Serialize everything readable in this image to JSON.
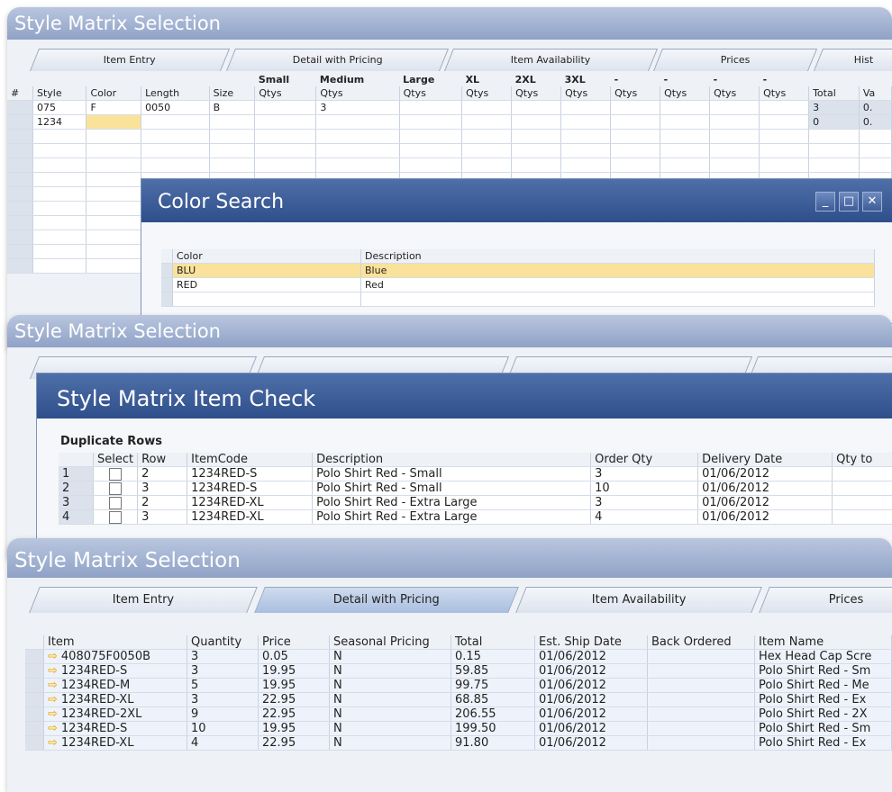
{
  "panel1": {
    "title": "Style Matrix Selection",
    "tabs": [
      "Item Entry",
      "Detail with Pricing",
      "Item Availability",
      "Prices",
      "Hist"
    ],
    "size_headers": [
      "Small",
      "Medium",
      "Large",
      "XL",
      "2XL",
      "3XL",
      "-",
      "-",
      "-",
      "-"
    ],
    "columns": [
      "#",
      "Style",
      "Color",
      "Length",
      "Size",
      "Qtys",
      "Qtys",
      "Qtys",
      "Qtys",
      "Qtys",
      "Qtys",
      "Qtys",
      "Qtys",
      "Qtys",
      "Qtys",
      "Total",
      "Va"
    ],
    "rows": [
      {
        "num": "",
        "style": "075",
        "color": "F",
        "length": "0050",
        "size": "B",
        "q2": "3",
        "total": "3",
        "va": "0."
      },
      {
        "num": "",
        "style": "1234",
        "color": "",
        "length": "",
        "size": "",
        "q2": "",
        "total": "0",
        "va": "0."
      }
    ]
  },
  "color_search": {
    "title": "Color Search",
    "columns": [
      "Color",
      "Description"
    ],
    "rows": [
      {
        "color": "BLU",
        "description": "Blue"
      },
      {
        "color": "RED",
        "description": "Red"
      }
    ]
  },
  "panel2": {
    "title": "Style Matrix Selection"
  },
  "item_check": {
    "title": "Style Matrix Item Check",
    "section": "Duplicate Rows",
    "columns": [
      "",
      "Select",
      "Row",
      "ItemCode",
      "Description",
      "Order Qty",
      "Delivery Date",
      "Qty to"
    ],
    "rows": [
      {
        "num": "1",
        "row": "2",
        "code": "1234RED-S",
        "desc": "Polo Shirt Red - Small",
        "qty": "3",
        "date": "01/06/2012"
      },
      {
        "num": "2",
        "row": "3",
        "code": "1234RED-S",
        "desc": "Polo Shirt Red - Small",
        "qty": "10",
        "date": "01/06/2012"
      },
      {
        "num": "3",
        "row": "2",
        "code": "1234RED-XL",
        "desc": "Polo Shirt Red - Extra Large",
        "qty": "3",
        "date": "01/06/2012"
      },
      {
        "num": "4",
        "row": "3",
        "code": "1234RED-XL",
        "desc": "Polo Shirt Red - Extra Large",
        "qty": "4",
        "date": "01/06/2012"
      }
    ]
  },
  "panel3": {
    "title": "Style Matrix Selection",
    "tabs": [
      "Item Entry",
      "Detail with Pricing",
      "Item Availability",
      "Prices"
    ],
    "columns": [
      "Item",
      "Quantity",
      "Price",
      "Seasonal Pricing",
      "Total",
      "Est. Ship Date",
      "Back Ordered",
      "Item Name"
    ],
    "rows": [
      {
        "item": "408075F0050B",
        "qty": "3",
        "price": "0.05",
        "seasonal": "N",
        "total": "0.15",
        "date": "01/06/2012",
        "name": "Hex Head Cap Scre"
      },
      {
        "item": "1234RED-S",
        "qty": "3",
        "price": "19.95",
        "seasonal": "N",
        "total": "59.85",
        "date": "01/06/2012",
        "name": "Polo Shirt Red - Sm"
      },
      {
        "item": "1234RED-M",
        "qty": "5",
        "price": "19.95",
        "seasonal": "N",
        "total": "99.75",
        "date": "01/06/2012",
        "name": "Polo Shirt Red - Me"
      },
      {
        "item": "1234RED-XL",
        "qty": "3",
        "price": "22.95",
        "seasonal": "N",
        "total": "68.85",
        "date": "01/06/2012",
        "name": "Polo Shirt Red - Ex"
      },
      {
        "item": "1234RED-2XL",
        "qty": "9",
        "price": "22.95",
        "seasonal": "N",
        "total": "206.55",
        "date": "01/06/2012",
        "name": "Polo Shirt Red - 2X"
      },
      {
        "item": "1234RED-S",
        "qty": "10",
        "price": "19.95",
        "seasonal": "N",
        "total": "199.50",
        "date": "01/06/2012",
        "name": "Polo Shirt Red - Sm"
      },
      {
        "item": "1234RED-XL",
        "qty": "4",
        "price": "22.95",
        "seasonal": "N",
        "total": "91.80",
        "date": "01/06/2012",
        "name": "Polo Shirt Red - Ex"
      }
    ]
  },
  "colors": {
    "highlight": "#fbe29a",
    "title_bar": "#2f4f8c",
    "row_arrow": "#f2b21b"
  }
}
